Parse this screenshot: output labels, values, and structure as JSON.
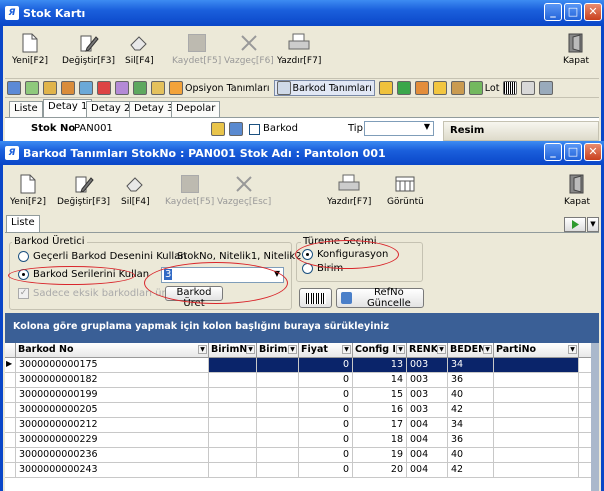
{
  "stok_window": {
    "title": "Stok Kartı",
    "toolbar": {
      "new": "Yeni[F2]",
      "edit": "Değiştir[F3]",
      "delete": "Sil[F4]",
      "save": "Kaydet[F5]",
      "cancel": "Vazgeç[F6]",
      "print": "Yazdır[F7]",
      "close": "Kapat"
    },
    "toolbar2": {
      "options": "Opsiyon Tanımları",
      "barcode": "Barkod Tanımları",
      "lot": "Lot"
    },
    "tabs": [
      "Liste",
      "Detay 1",
      "Detay 2",
      "Detay 3",
      "Depolar"
    ],
    "stock_no_label": "Stok No",
    "stock_no_value": "PAN001",
    "barcode_check_label": "Barkod",
    "tip_label": "Tip",
    "resim_label": "Resim"
  },
  "barkod_window": {
    "title": "Barkod Tanımları StokNo :  PAN001 Stok Adı :  Pantolon 001",
    "toolbar": {
      "new": "Yeni[F2]",
      "edit": "Değiştir[F3]",
      "delete": "Sil[F4]",
      "save": "Kaydet[F5]",
      "cancel": "Vazgeç[Esc]",
      "print": "Yazdır[F7]",
      "view": "Görüntü",
      "close": "Kapat"
    },
    "tab": "Liste",
    "uretici": {
      "group_label": "Barkod Üretici",
      "radio1": "Geçerli Barkod Desenini Kullan",
      "pattern_text": "StokNo, Nitelik1, Nitelik2",
      "radio2": "Barkod Serilerini Kullan",
      "checkbox": "Sadece eksik barkodları üret",
      "combo_value": "3",
      "generate_button": "Barkod Üret"
    },
    "tureme": {
      "group_label": "Türeme Seçimi",
      "radio1": "Konfigurasyon",
      "radio2": "Birim"
    },
    "refno_button": "RefNo Güncelle",
    "group_hint": "Kolona göre gruplama yapmak için kolon başlığını buraya sürükleyiniz",
    "columns": [
      "Barkod No",
      "BirimN",
      "Birim",
      "Fiyat",
      "Config I",
      "RENK",
      "BEDEN",
      "PartiNo"
    ],
    "rows": [
      {
        "barkod": "3000000000175",
        "fiyat": "0",
        "config": "13",
        "renk": "003",
        "beden": "34"
      },
      {
        "barkod": "3000000000182",
        "fiyat": "0",
        "config": "14",
        "renk": "003",
        "beden": "36"
      },
      {
        "barkod": "3000000000199",
        "fiyat": "0",
        "config": "15",
        "renk": "003",
        "beden": "40"
      },
      {
        "barkod": "3000000000205",
        "fiyat": "0",
        "config": "16",
        "renk": "003",
        "beden": "42"
      },
      {
        "barkod": "3000000000212",
        "fiyat": "0",
        "config": "17",
        "renk": "004",
        "beden": "34"
      },
      {
        "barkod": "3000000000229",
        "fiyat": "0",
        "config": "18",
        "renk": "004",
        "beden": "36"
      },
      {
        "barkod": "3000000000236",
        "fiyat": "0",
        "config": "19",
        "renk": "004",
        "beden": "40"
      },
      {
        "barkod": "3000000000243",
        "fiyat": "0",
        "config": "20",
        "renk": "004",
        "beden": "42"
      }
    ]
  }
}
